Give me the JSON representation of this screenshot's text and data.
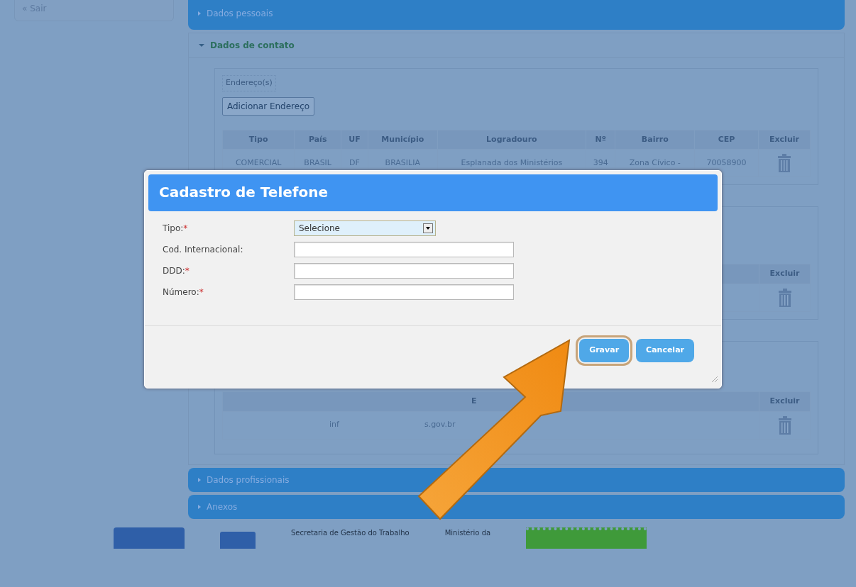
{
  "sidebar": {
    "items": [
      {
        "label": "« Sair"
      }
    ]
  },
  "sections": [
    {
      "title": "Dados pessoais",
      "expanded": false
    },
    {
      "title": "Dados de contato",
      "expanded": true
    },
    {
      "title": "Dados profissionais",
      "expanded": false
    },
    {
      "title": "Anexos",
      "expanded": false
    }
  ],
  "contact": {
    "address": {
      "legend": "Endereço(s)",
      "add_button": "Adicionar Endereço",
      "columns": [
        "Tipo",
        "País",
        "UF",
        "Município",
        "Logradouro",
        "Nº",
        "Bairro",
        "CEP",
        "Excluir"
      ],
      "rows": [
        [
          "COMERCIAL",
          "BRASIL",
          "DF",
          "BRASILIA",
          "Esplanada dos Ministérios",
          "394",
          "Zona Cívico -",
          "70058900"
        ]
      ]
    },
    "phone": {
      "columns": [
        "Excluir"
      ]
    },
    "email": {
      "columns": [
        "E",
        "Excluir"
      ],
      "rows": [
        {
          "address_parts": [
            "inf",
            "s.gov.br"
          ]
        }
      ]
    }
  },
  "modal": {
    "title": "Cadastro de Telefone",
    "fields": [
      {
        "kind": "select",
        "label": "Tipo:",
        "required_mark": "*",
        "value": "Selecione"
      },
      {
        "kind": "text",
        "label": "Cod. Internacional:"
      },
      {
        "kind": "text",
        "label": "DDD:",
        "required_mark": "*"
      },
      {
        "kind": "text",
        "label": "Número:",
        "required_mark": "*"
      }
    ],
    "buttons": [
      {
        "label": "Gravar",
        "focused": true
      },
      {
        "label": "Cancelar",
        "focused": false
      }
    ]
  },
  "footer": {
    "texts": [
      "Secretaria de Gestão do Trabalho",
      "Ministério da"
    ]
  }
}
